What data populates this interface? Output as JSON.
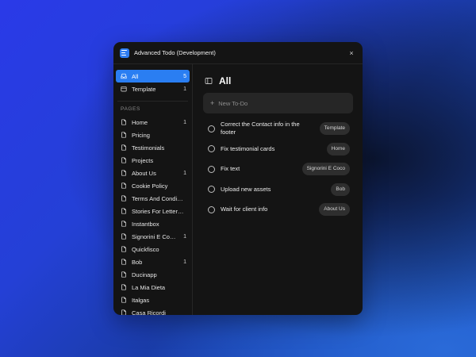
{
  "window": {
    "title": "Advanced Todo (Development)",
    "close_glyph": "×"
  },
  "sidebar": {
    "filters": [
      {
        "label": "All",
        "count": "5",
        "icon": "inbox-icon",
        "active": true
      },
      {
        "label": "Template",
        "count": "1",
        "icon": "calendar-icon",
        "active": false
      }
    ],
    "pages_label": "PAGES",
    "pages": [
      {
        "label": "Home",
        "count": "1"
      },
      {
        "label": "Pricing",
        "count": ""
      },
      {
        "label": "Testimonials",
        "count": ""
      },
      {
        "label": "Projects",
        "count": ""
      },
      {
        "label": "About Us",
        "count": "1"
      },
      {
        "label": "Cookie Policy",
        "count": ""
      },
      {
        "label": "Terms And Condi…",
        "count": ""
      },
      {
        "label": "Stories For Letter…",
        "count": ""
      },
      {
        "label": "Instantbox",
        "count": ""
      },
      {
        "label": "Signorini E Co…",
        "count": "1"
      },
      {
        "label": "Quickfisco",
        "count": ""
      },
      {
        "label": "Bob",
        "count": "1"
      },
      {
        "label": "Ducinapp",
        "count": ""
      },
      {
        "label": "La Mia Dieta",
        "count": ""
      },
      {
        "label": "Italgas",
        "count": ""
      },
      {
        "label": "Casa Ricordi",
        "count": ""
      }
    ]
  },
  "main": {
    "title": "All",
    "new_todo_placeholder": "New To-Do",
    "new_todo_glyph": "+",
    "todos": [
      {
        "text": "Correct the Contact info in the footer",
        "tag": "Template"
      },
      {
        "text": "Fix testimonial cards",
        "tag": "Home"
      },
      {
        "text": "Fix text",
        "tag": "Signorini E Coco"
      },
      {
        "text": "Upload new assets",
        "tag": "Bob"
      },
      {
        "text": "Wait for client info",
        "tag": "About Us"
      }
    ]
  },
  "colors": {
    "accent": "#2a7ef2",
    "window_bg": "#141414",
    "tag_bg": "#2e2e2e"
  }
}
